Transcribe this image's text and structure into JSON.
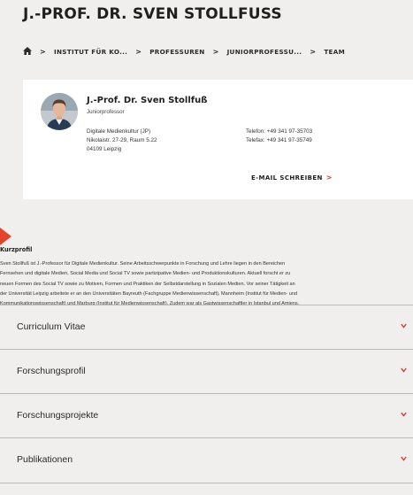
{
  "page": {
    "title": "J.-PROF. DR. SVEN STOLLFUSS"
  },
  "breadcrumb": {
    "items": [
      "INSTITUT FÜR KO...",
      "PROFESSUREN",
      "JUNIORPROFESSU...",
      "TEAM"
    ],
    "separator": ">",
    "home_icon": "home-icon"
  },
  "card": {
    "name": "J.-Prof. Dr. Sven Stollfuß",
    "role": "Juniorprofessor",
    "address": [
      "Digitale Medienkultur (JP)",
      "Nikolaistr. 27-29, Raum 5.22",
      "04109 Leipzig"
    ],
    "phone": "Telefon: +49 341 97-35703",
    "fax": "Telefax: +49 341 97-35749",
    "email_label": "E-MAIL SCHREIBEN",
    "email_chevron": ">"
  },
  "profile": {
    "heading": "Kurzprofil",
    "lines": [
      "Sven Stollfuß ist J.-Professor für Digitale Medienkultur. Seine Arbeitsschwerpunkte in Forschung und Lehre liegen in den Bereichen",
      "Fernsehen und digitale Medien, Social Media und Social TV sowie partizipative Medien- und Produktionskulturen. Aktuell forscht er zu",
      "neuen Formen des Social TV sowie zu Motiven, Formen und Praktiken der Selbstdarstellung in Sozialen Medien. Vor seiner Tätigkeit an",
      "der Universität Leipzig arbeitete er an den Universitäten Bayreuth (Fachgruppe Medienwissenschaft), Mannheim (Institut für Medien- und",
      "Kommunikationswissenschaft) und Marburg (Institut für Medienwissenschaft). Zudem war als Gastwissenschaftler in Istanbul und Amiens."
    ]
  },
  "accordion": {
    "items": [
      "Curriculum Vitae",
      "Forschungsprofil",
      "Forschungsprojekte",
      "Publikationen"
    ]
  },
  "colors": {
    "accent": "#e3452c",
    "background": "#f0efed",
    "card": "#ffffff",
    "text": "#1f1f1f"
  }
}
